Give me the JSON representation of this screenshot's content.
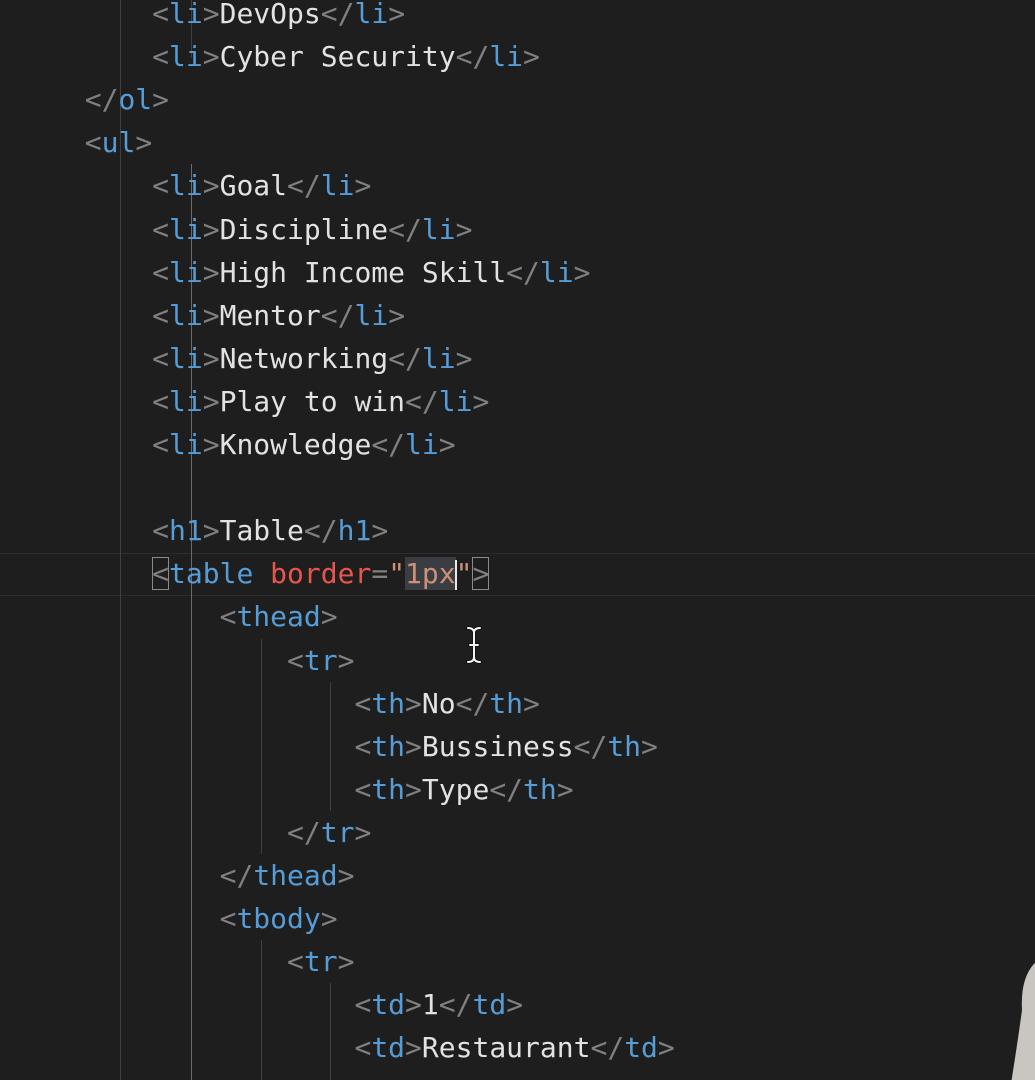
{
  "editor": {
    "language": "html",
    "lines": [
      {
        "indent": "        ",
        "tag": "li",
        "text": "DevOps"
      },
      {
        "indent": "        ",
        "tag": "li",
        "text": "Cyber Security"
      },
      {
        "indent": "    ",
        "close": "ol"
      },
      {
        "indent": "    ",
        "open": "ul"
      },
      {
        "indent": "        ",
        "tag": "li",
        "text": "Goal"
      },
      {
        "indent": "        ",
        "tag": "li",
        "text": "Discipline"
      },
      {
        "indent": "        ",
        "tag": "li",
        "text": "High Income Skill"
      },
      {
        "indent": "        ",
        "tag": "li",
        "text": "Mentor"
      },
      {
        "indent": "        ",
        "tag": "li",
        "text": "Networking"
      },
      {
        "indent": "        ",
        "tag": "li",
        "text": "Play to win"
      },
      {
        "indent": "        ",
        "tag": "li",
        "text": "Knowledge"
      },
      {
        "indent": "",
        "blank": true
      },
      {
        "indent": "        ",
        "tag": "h1",
        "text": "Table"
      },
      {
        "indent": "        ",
        "open": "table",
        "attr": "border",
        "value_before_caret": "1px",
        "value_after_caret": "",
        "current": true
      },
      {
        "indent": "            ",
        "open": "thead"
      },
      {
        "indent": "                ",
        "open": "tr"
      },
      {
        "indent": "                    ",
        "tag": "th",
        "text": "No"
      },
      {
        "indent": "                    ",
        "tag": "th",
        "text": "Bussiness"
      },
      {
        "indent": "                    ",
        "tag": "th",
        "text": "Type"
      },
      {
        "indent": "                ",
        "close": "tr"
      },
      {
        "indent": "            ",
        "close": "thead"
      },
      {
        "indent": "            ",
        "open": "tbody"
      },
      {
        "indent": "                ",
        "open": "tr"
      },
      {
        "indent": "                    ",
        "tag": "td",
        "text": "1"
      },
      {
        "indent": "                    ",
        "tag": "td",
        "text": "Restaurant"
      }
    ]
  },
  "colors": {
    "background": "#1e1e1e",
    "punctuation": "#808080",
    "tag": "#569cd6",
    "attribute": "#e8554e",
    "string": "#ce9178",
    "text": "#e2e2e2"
  },
  "cursor": {
    "icon": "text-cursor-icon"
  }
}
